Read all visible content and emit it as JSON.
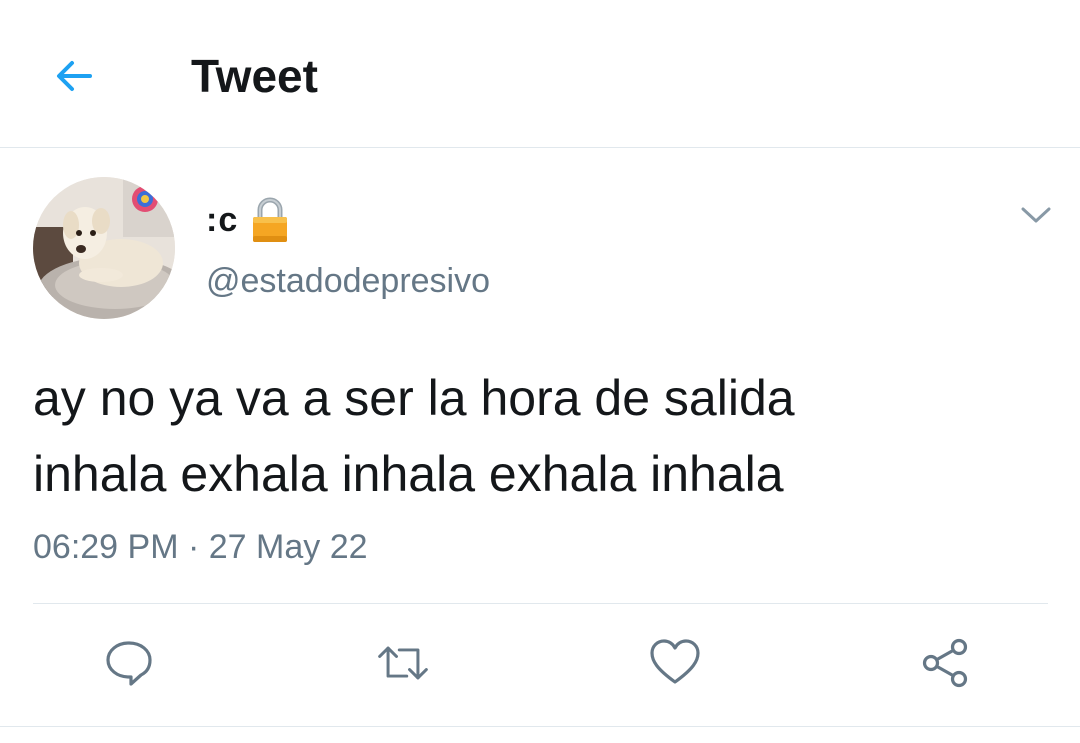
{
  "header": {
    "title": "Tweet",
    "back_icon": "arrow-left-icon",
    "accent_color": "#1da1f2"
  },
  "tweet": {
    "author": {
      "display_name": ":c",
      "handle": "@estadodepresivo",
      "protected_icon": "lock-icon",
      "avatar": "dog-photo-avatar"
    },
    "menu_icon": "chevron-down-icon",
    "text_lines": [
      "ay no ya va a ser la hora de salida",
      "inhala exhala inhala exhala inhala"
    ],
    "time": "06:29 PM",
    "separator": "·",
    "date": "27 May 22",
    "actions": [
      {
        "name": "reply",
        "icon": "comment-icon"
      },
      {
        "name": "retweet",
        "icon": "retweet-icon"
      },
      {
        "name": "like",
        "icon": "heart-icon"
      },
      {
        "name": "share",
        "icon": "share-icon"
      }
    ],
    "colors": {
      "text": "#14171a",
      "secondary": "#657786",
      "border": "#e1e8ed"
    }
  }
}
